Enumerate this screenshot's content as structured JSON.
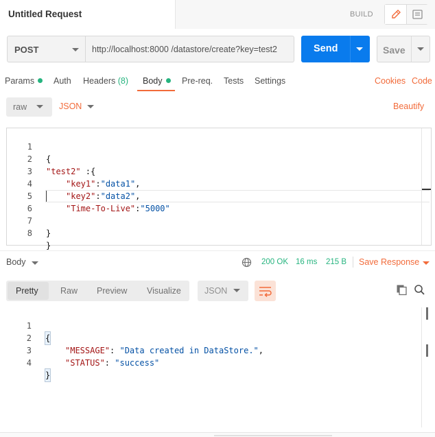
{
  "colors": {
    "accent": "#f26b3a",
    "primary": "#097bed",
    "success": "#26b47f",
    "string": "#a31515",
    "value": "#0451a5"
  },
  "tab": {
    "title": "Untitled Request"
  },
  "header": {
    "build_label": "BUILD",
    "edit_icon": "pencil-icon",
    "doc_icon": "document-icon"
  },
  "request": {
    "method": "POST",
    "url": "http://localhost:8000 /datastore/create?key=test2",
    "send_label": "Send",
    "save_label": "Save"
  },
  "request_tabs": {
    "params": "Params",
    "auth": "Auth",
    "headers": "Headers",
    "headers_count": "(8)",
    "body": "Body",
    "prereq": "Pre-req.",
    "tests": "Tests",
    "settings": "Settings",
    "cookies": "Cookies",
    "code": "Code"
  },
  "body_options": {
    "mode": "raw",
    "format": "JSON",
    "beautify": "Beautify"
  },
  "request_body": {
    "line_numbers": [
      "1",
      "2",
      "3",
      "4",
      "5",
      "6",
      "7",
      "8"
    ],
    "l1": "{",
    "l2_key": "\"test2\"",
    "l2_rest": " :{",
    "l3_key": "\"key1\"",
    "l3_val": "\"data1\"",
    "l4_key": "\"key2\"",
    "l4_val": "\"data2\"",
    "l5_key": "\"Time-To-Live\"",
    "l5_val": "\"5000\"",
    "l7": "}",
    "l8": "}"
  },
  "response": {
    "body_label": "Body",
    "status": "200 OK",
    "time": "16 ms",
    "size": "215 B",
    "save_response": "Save Response",
    "views": [
      "Pretty",
      "Raw",
      "Preview",
      "Visualize"
    ],
    "format": "JSON",
    "line_numbers": [
      "1",
      "2",
      "3",
      "4"
    ],
    "l1": "{",
    "l2_key": "\"MESSAGE\"",
    "l2_val": "\"Data created in DataStore.\"",
    "l3_key": "\"STATUS\"",
    "l3_val": "\"success\"",
    "l4": "}"
  }
}
